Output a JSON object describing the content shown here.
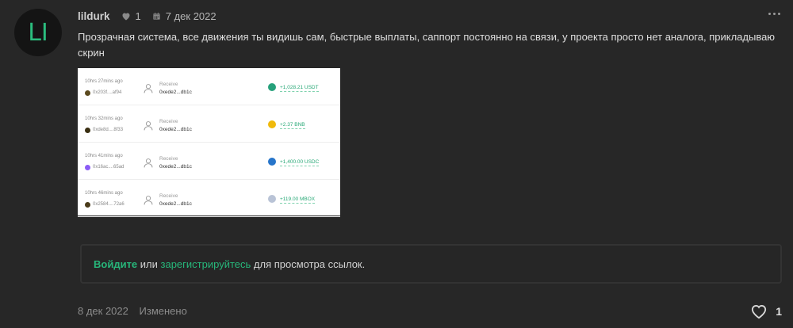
{
  "post": {
    "avatar_initials": "LI",
    "username": "lildurk",
    "like_count": "1",
    "date": "7 дек 2022",
    "text": "Прозрачная система, все движения ты видишь сам, быстрые выплаты, саппорт постоянно на связи, у проекта просто нет аналога, прикладываю скрин"
  },
  "screenshot": {
    "rows": [
      {
        "time": "10hrs 27mins ago",
        "addr": "0x203f....af94",
        "label": "Receive",
        "dest": "0xede2...db1c",
        "amount": "+1,028.21 USDT",
        "token_color": "#26a17b",
        "coin_color": "#5c4a1f"
      },
      {
        "time": "10hrs 32mins ago",
        "addr": "0xde8d....8f33",
        "label": "Receive",
        "dest": "0xede2...db1c",
        "amount": "+2.37 BNB",
        "token_color": "#f0b90b",
        "coin_color": "#3a2f12"
      },
      {
        "time": "10hrs 41mins ago",
        "addr": "0x16ac....65ad",
        "label": "Receive",
        "dest": "0xede2...db1c",
        "amount": "+1,400.00 USDC",
        "token_color": "#2775ca",
        "coin_color": "#8b5cf6"
      },
      {
        "time": "10hrs 46mins ago",
        "addr": "0x2584....72a6",
        "label": "Receive",
        "dest": "0xede2...db1c",
        "amount": "+119.00 MBOX",
        "token_color": "#b9c3d6",
        "coin_color": "#4a3b1a"
      }
    ]
  },
  "login_notice": {
    "login_link": "Войдите",
    "or": " или ",
    "register_link": "зарегистрируйтесь",
    "suffix": " для просмотра ссылок."
  },
  "footer": {
    "date": "8 дек 2022",
    "edited": "Изменено",
    "like_count": "1"
  },
  "colors": {
    "background": "#272727",
    "accent": "#27b67a"
  }
}
